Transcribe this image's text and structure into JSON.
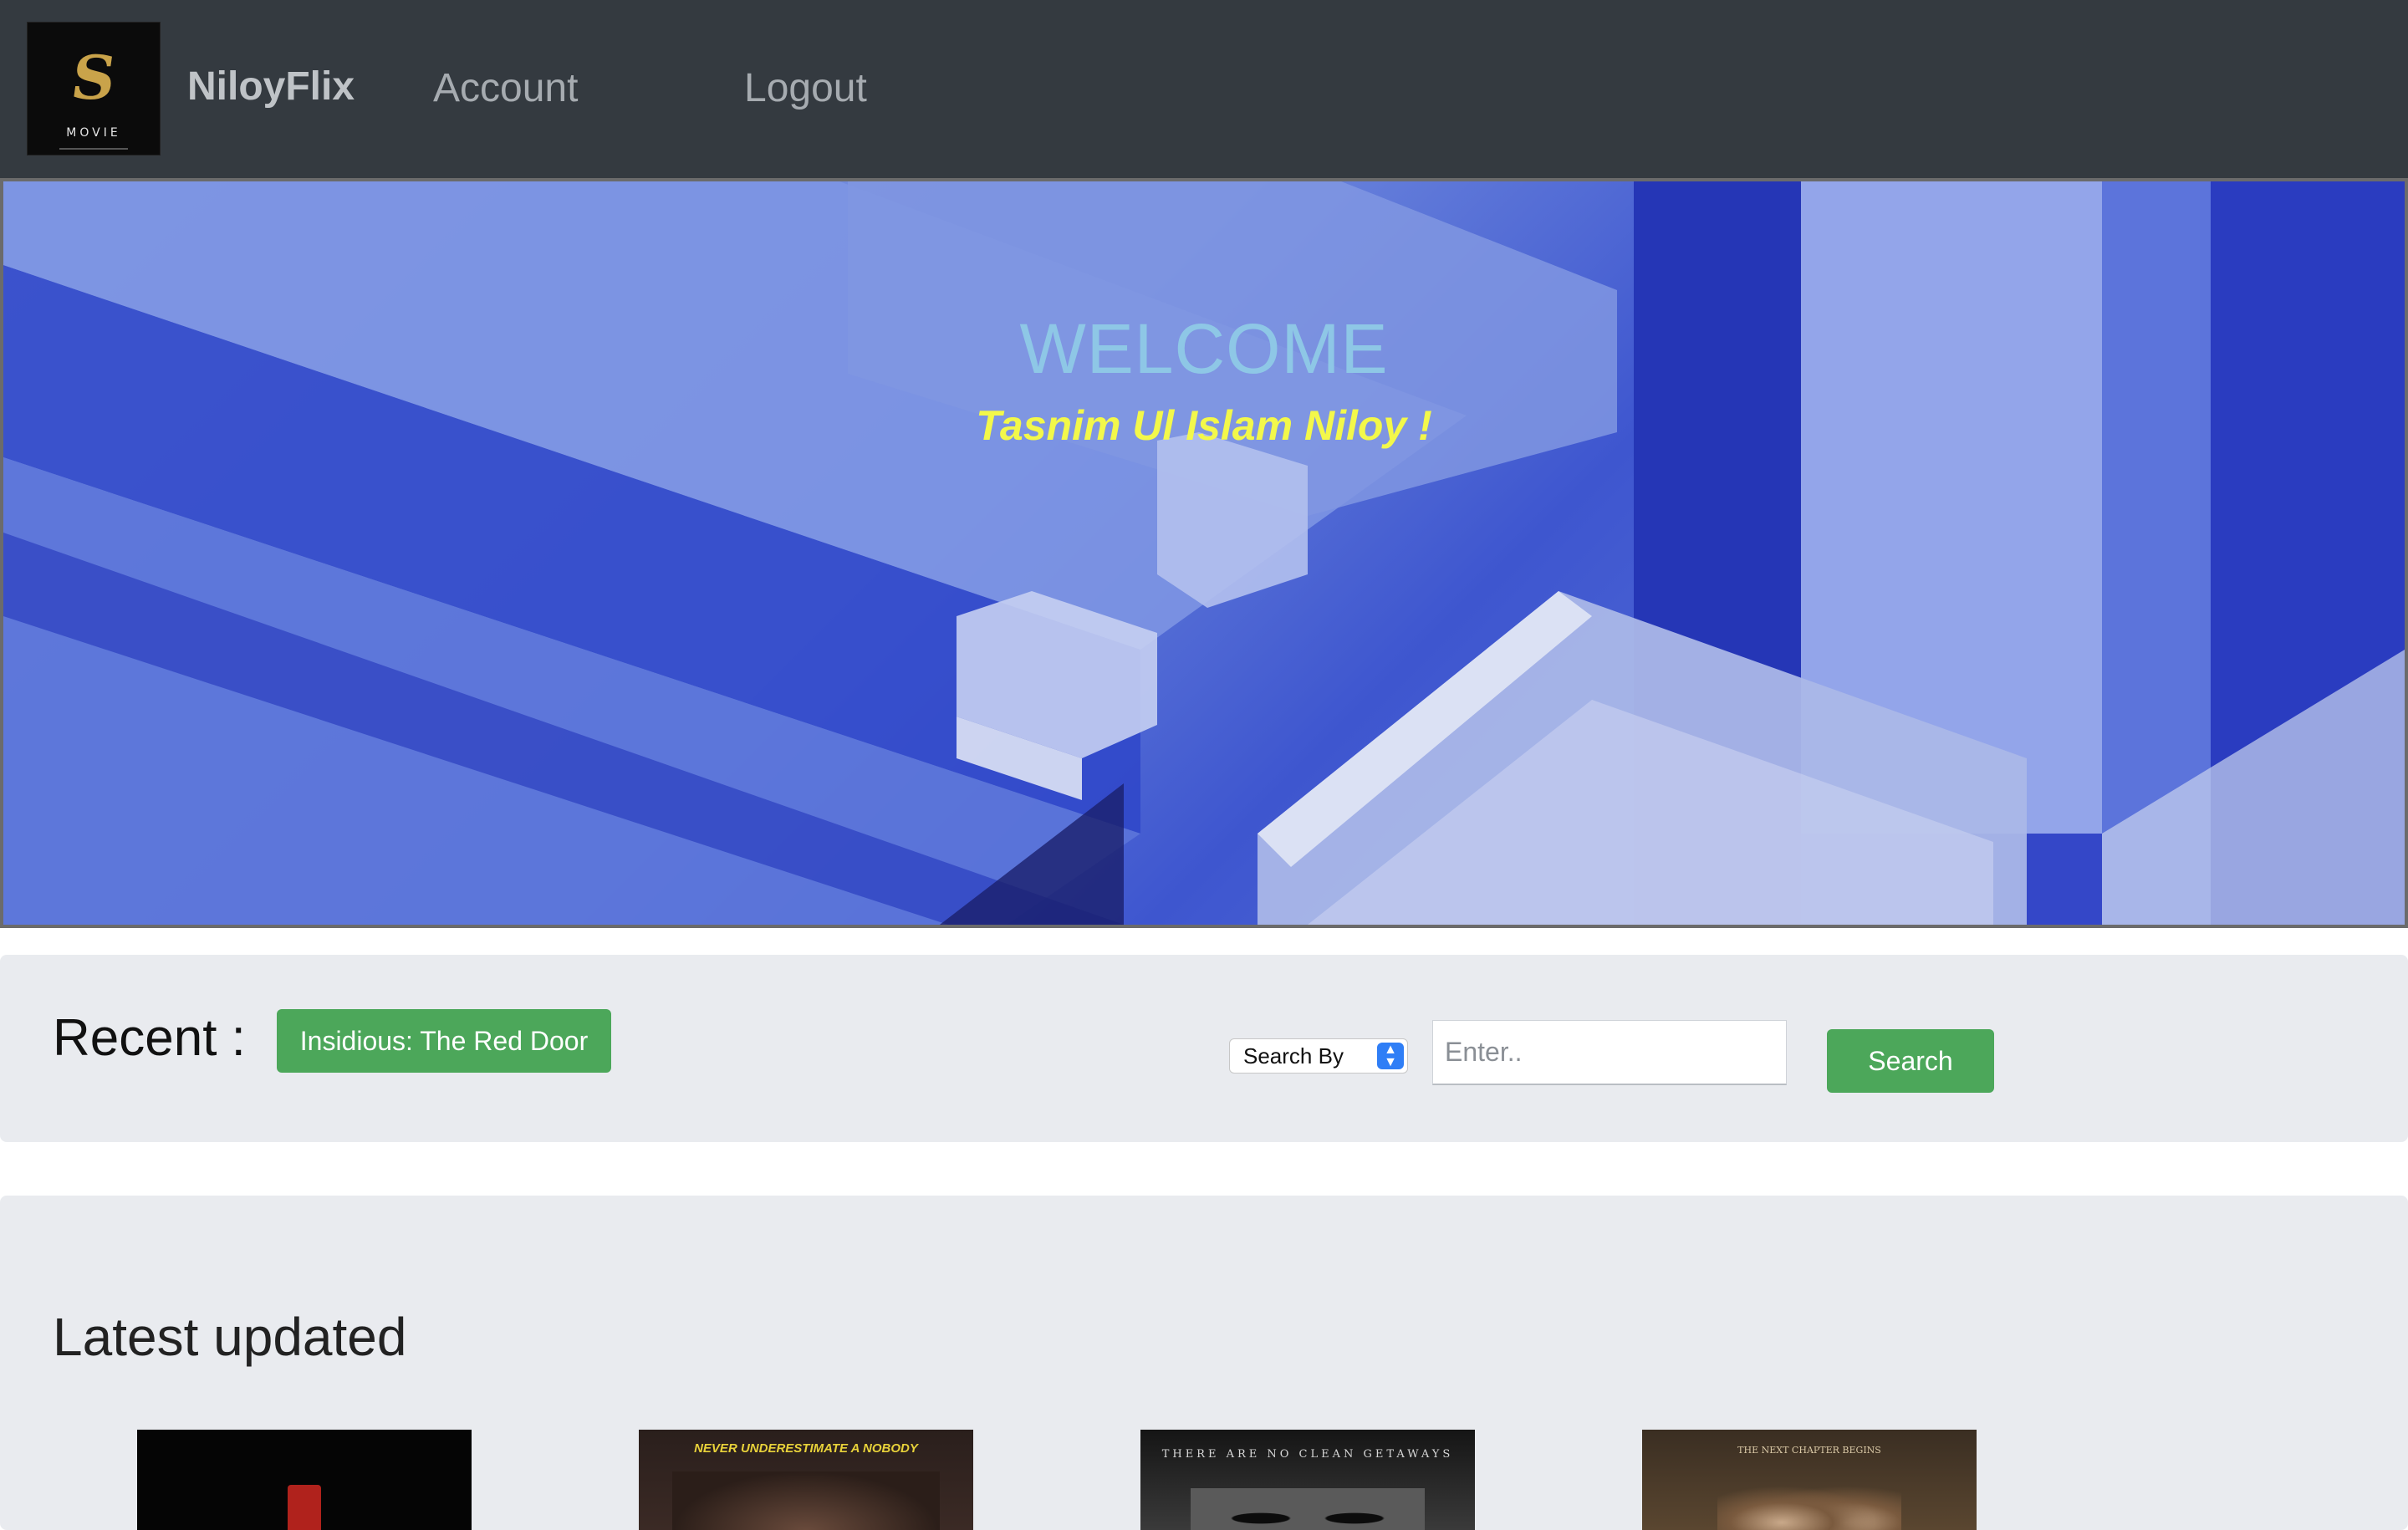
{
  "navbar": {
    "logo_word": "MOVIE",
    "brand": "NiloyFlix",
    "links": [
      {
        "label": "Account"
      },
      {
        "label": "Logout"
      }
    ]
  },
  "hero": {
    "welcome": "WELCOME",
    "greeting": "Tasnim Ul Islam Niloy !"
  },
  "recent": {
    "title": "Recent :",
    "item": "Insidious: The Red Door"
  },
  "search": {
    "select_label": "Search By",
    "input_placeholder": "Enter..",
    "button_label": "Search"
  },
  "latest": {
    "title": "Latest updated",
    "posters": [
      {
        "tagline": ""
      },
      {
        "tagline": "NEVER UNDERESTIMATE A NOBODY"
      },
      {
        "tagline": "THERE ARE NO CLEAN GETAWAYS"
      },
      {
        "tagline": "THE NEXT CHAPTER BEGINS"
      }
    ]
  },
  "colors": {
    "navbar_bg": "#343a40",
    "accent_green": "#4ca75a",
    "welcome_text": "#8ec7e6",
    "greeting_text": "#f3f84a",
    "panel_bg": "#e9ebef"
  },
  "icons": {
    "select_arrow": "chevron-updown-icon"
  }
}
